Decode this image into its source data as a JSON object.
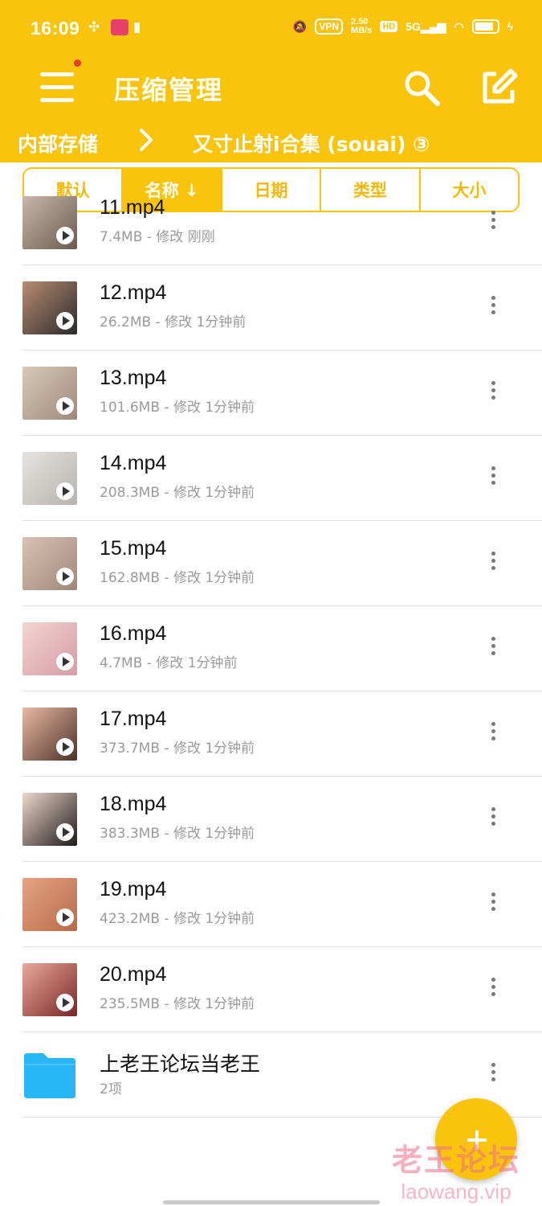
{
  "status": {
    "time": "16:09",
    "speed_top": "2.50",
    "speed_bottom": "MB/s",
    "vpn": "VPN",
    "hd": "HD",
    "net": "5G"
  },
  "appbar": {
    "title": "压缩管理",
    "menu_icon": "hamburger-icon",
    "search_icon": "search-icon",
    "edit_icon": "edit-icon"
  },
  "breadcrumb": {
    "parent": "内部存储",
    "current": "又寸止射i合集 (souai) ③"
  },
  "sort": {
    "tabs": [
      {
        "label": "默认"
      },
      {
        "label": "名称 ↓"
      },
      {
        "label": "日期"
      },
      {
        "label": "类型"
      },
      {
        "label": "大小"
      }
    ],
    "active_index": 1
  },
  "files": [
    {
      "name": "11.mp4",
      "meta": "7.4MB - 修改 刚刚",
      "thumb": [
        "#c9b7aa",
        "#6e5a4f"
      ]
    },
    {
      "name": "12.mp4",
      "meta": "26.2MB - 修改 1分钟前",
      "thumb": [
        "#b98c72",
        "#2a2a2a"
      ]
    },
    {
      "name": "13.mp4",
      "meta": "101.6MB - 修改 1分钟前",
      "thumb": [
        "#d9c8b8",
        "#9e8a7c"
      ]
    },
    {
      "name": "14.mp4",
      "meta": "208.3MB - 修改 1分钟前",
      "thumb": [
        "#e6e3e0",
        "#b7b2ad"
      ]
    },
    {
      "name": "15.mp4",
      "meta": "162.8MB - 修改 1分钟前",
      "thumb": [
        "#d8c2b4",
        "#a08779"
      ]
    },
    {
      "name": "16.mp4",
      "meta": "4.7MB - 修改 1分钟前",
      "thumb": [
        "#f2d6d0",
        "#d79aa7"
      ]
    },
    {
      "name": "17.mp4",
      "meta": "373.7MB - 修改 1分钟前",
      "thumb": [
        "#e8b9a3",
        "#4e3228"
      ]
    },
    {
      "name": "18.mp4",
      "meta": "383.3MB - 修改 1分钟前",
      "thumb": [
        "#efd8cc",
        "#1e1a1a"
      ]
    },
    {
      "name": "19.mp4",
      "meta": "423.2MB - 修改 1分钟前",
      "thumb": [
        "#e4a583",
        "#b86a48"
      ]
    },
    {
      "name": "20.mp4",
      "meta": "235.5MB - 修改 1分钟前",
      "thumb": [
        "#e9a99c",
        "#7a2626"
      ]
    }
  ],
  "folder": {
    "name": "上老王论坛当老王",
    "meta": "2项",
    "icon": "folder-icon",
    "color": "#29b6f6"
  },
  "fab": {
    "icon": "plus-icon"
  },
  "watermark": {
    "line1": "老王论坛",
    "line2": "laowang.vip"
  },
  "colors": {
    "accent": "#f9c40b",
    "meta_text": "#9a9a9a"
  }
}
